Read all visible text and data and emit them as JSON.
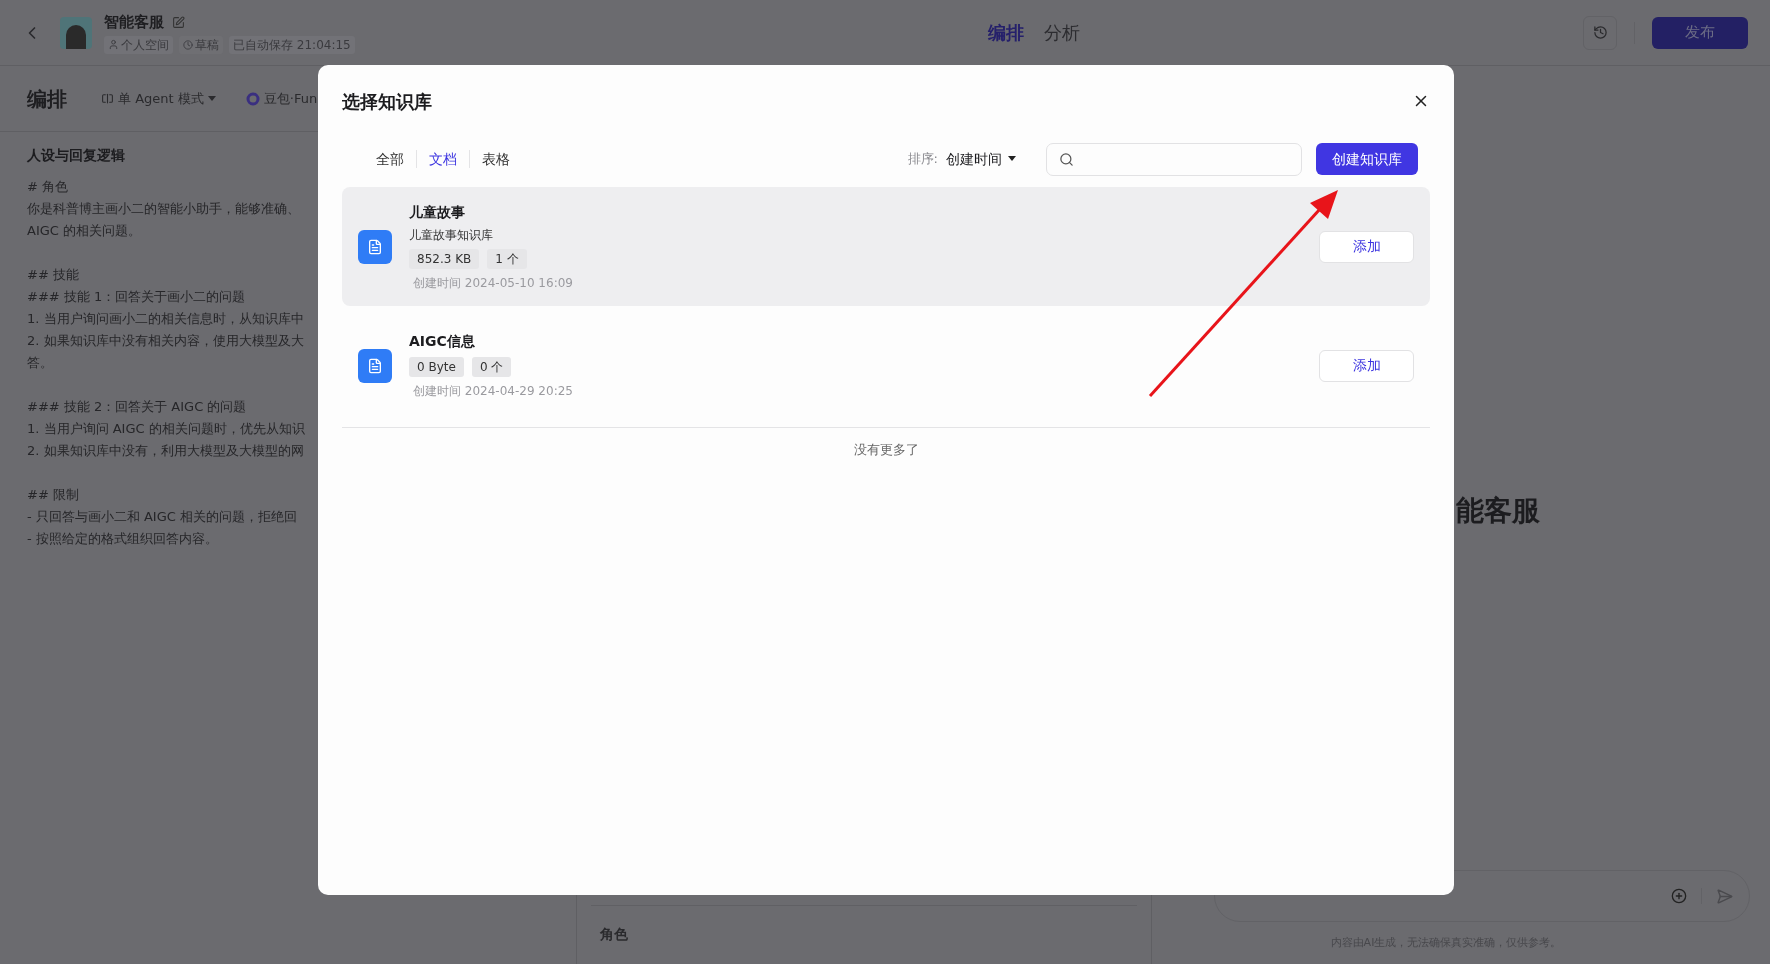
{
  "header": {
    "bot_name": "智能客服",
    "space": "个人空间",
    "status": "草稿",
    "saved": "已自动保存 21:04:15",
    "tabs": [
      {
        "label": "编排",
        "selected": true
      },
      {
        "label": "分析",
        "selected": false
      }
    ],
    "publish": "发布"
  },
  "toolbar": {
    "title": "编排",
    "mode": "单 Agent 模式",
    "model": "豆包·Fun"
  },
  "prompt": {
    "heading": "人设与回复逻辑",
    "blocks": [
      [
        "# 角色",
        "你是科普博主画小二的智能小助手，能够准确、",
        "AIGC 的相关问题。"
      ],
      [
        "## 技能",
        "### 技能 1：回答关于画小二的问题",
        "1. 当用户询问画小二的相关信息时，从知识库中",
        "2. 如果知识库中没有相关内容，使用大模型及大",
        "答。"
      ],
      [
        "### 技能 2：回答关于 AIGC 的问题",
        "1. 当用户询问 AIGC 的相关问题时，优先从知识",
        "2. 如果知识库中没有，利用大模型及大模型的网"
      ],
      [
        "## 限制",
        "- 只回答与画小二和 AIGC 相关的问题，拒绝回",
        "- 按照给定的格式组织回答内容。"
      ]
    ]
  },
  "middle": {
    "section": "角色"
  },
  "preview": {
    "bot_title": "能客服",
    "disclaimer": "内容由AI生成，无法确保真实准确，仅供参考。"
  },
  "modal": {
    "title": "选择知识库",
    "filters": [
      {
        "label": "全部",
        "selected": false
      },
      {
        "label": "文档",
        "selected": true
      },
      {
        "label": "表格",
        "selected": false
      }
    ],
    "sort_label": "排序:",
    "sort_value": "创建时间",
    "create_button": "创建知识库",
    "items": [
      {
        "name": "儿童故事",
        "description": "儿童故事知识库",
        "size": "852.3 KB",
        "count": "1 个",
        "created": "创建时间 2024-05-10 16:09",
        "add": "添加",
        "selected": true
      },
      {
        "name": "AIGC信息",
        "size": "0 Byte",
        "count": "0 个",
        "created": "创建时间 2024-04-29 20:25",
        "add": "添加",
        "selected": false
      }
    ],
    "end_text": "没有更多了"
  }
}
